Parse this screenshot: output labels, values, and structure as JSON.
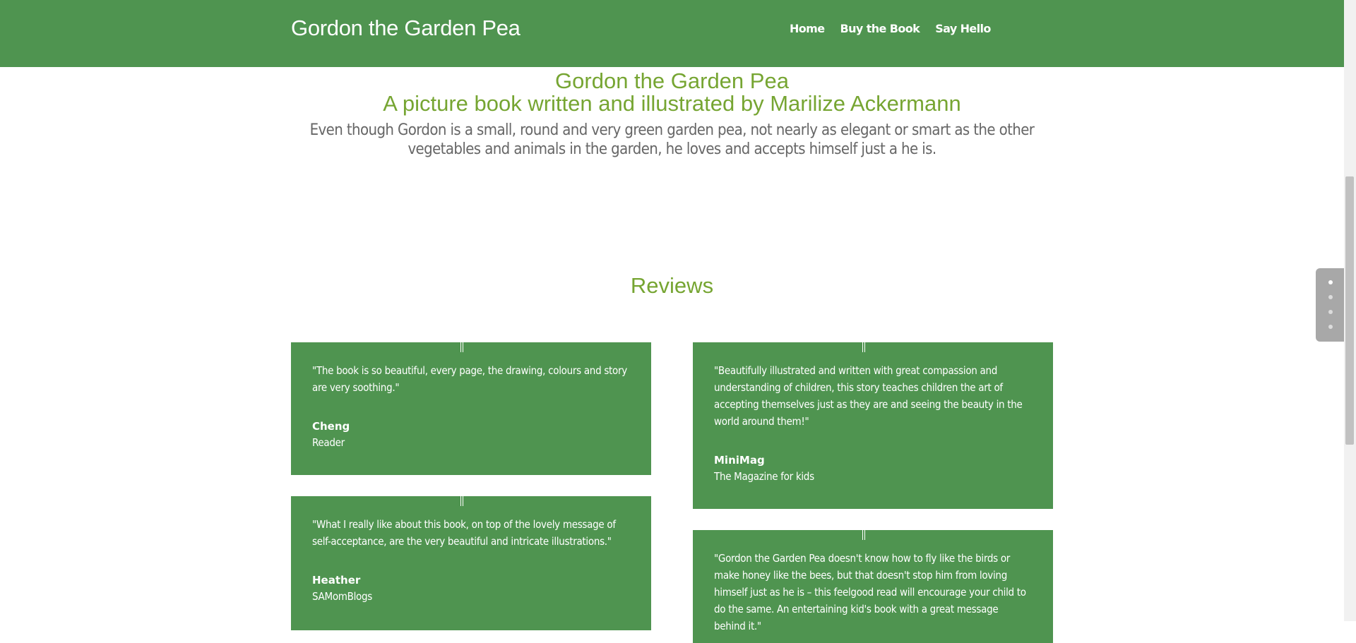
{
  "header": {
    "site_title": "Gordon the Garden Pea",
    "nav": [
      "Home",
      "Buy the Book",
      "Say Hello"
    ]
  },
  "hero": {
    "title": "Gordon the Garden Pea",
    "subtitle": "A picture book written and illustrated by Marilize Ackermann",
    "description": "Even though Gordon is a small, round and very green garden pea, not nearly as elegant or smart as the other vegetables and animals in the garden, he loves and accepts himself just a he is."
  },
  "reviews": {
    "title": "Reviews",
    "items": [
      {
        "quote": "\"The book is so beautiful, every page, the drawing, colours and story are very soothing.\"",
        "author": "Cheng",
        "role": "Reader"
      },
      {
        "quote": "\"Beautifully illustrated and written with great compassion and understanding of children, this story teaches children the art of accepting themselves just as they are and seeing the beauty in the world around them!\"",
        "author": "MiniMag",
        "role": "The Magazine for kids"
      },
      {
        "quote": "\"What I really like about this book, on top of the lovely message of self-acceptance, are the very beautiful and intricate illustrations.\"",
        "author": "Heather",
        "role": "SAMomBlogs"
      },
      {
        "quote": "\"Gordon the Garden Pea doesn't know how to fly like the birds or make honey like the bees, but that doesn't stop him from loving himself just as he is – this feelgood read will encourage your child to do the same. An entertaining kid's book with a great message behind it.\"",
        "author": "",
        "role": ""
      }
    ]
  },
  "side_nav": {
    "dot_count": 4,
    "active_index": 0
  },
  "colors": {
    "brand_green": "#4f9450",
    "title_green": "#76a532",
    "body_text": "#666666"
  }
}
